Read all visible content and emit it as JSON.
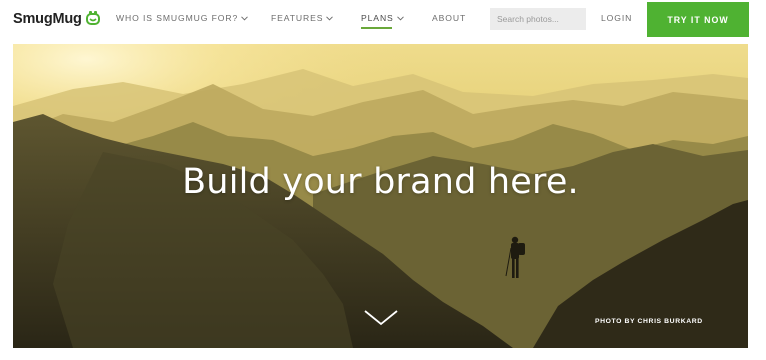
{
  "brand": {
    "name": "SmugMug",
    "accent_color": "#4fb232"
  },
  "nav": {
    "items": [
      {
        "label": "WHO IS SMUGMUG FOR?",
        "has_dropdown": true
      },
      {
        "label": "FEATURES",
        "has_dropdown": true
      },
      {
        "label": "PLANS",
        "has_dropdown": true,
        "active": true
      },
      {
        "label": "ABOUT",
        "has_dropdown": false
      }
    ],
    "search_placeholder": "Search photos...",
    "login_label": "LOGIN",
    "cta_label": "TRY IT NOW"
  },
  "hero": {
    "headline": "Build your brand here.",
    "photo_credit": "PHOTO BY CHRIS BURKARD",
    "scroll_icon": "chevron-down-icon"
  }
}
